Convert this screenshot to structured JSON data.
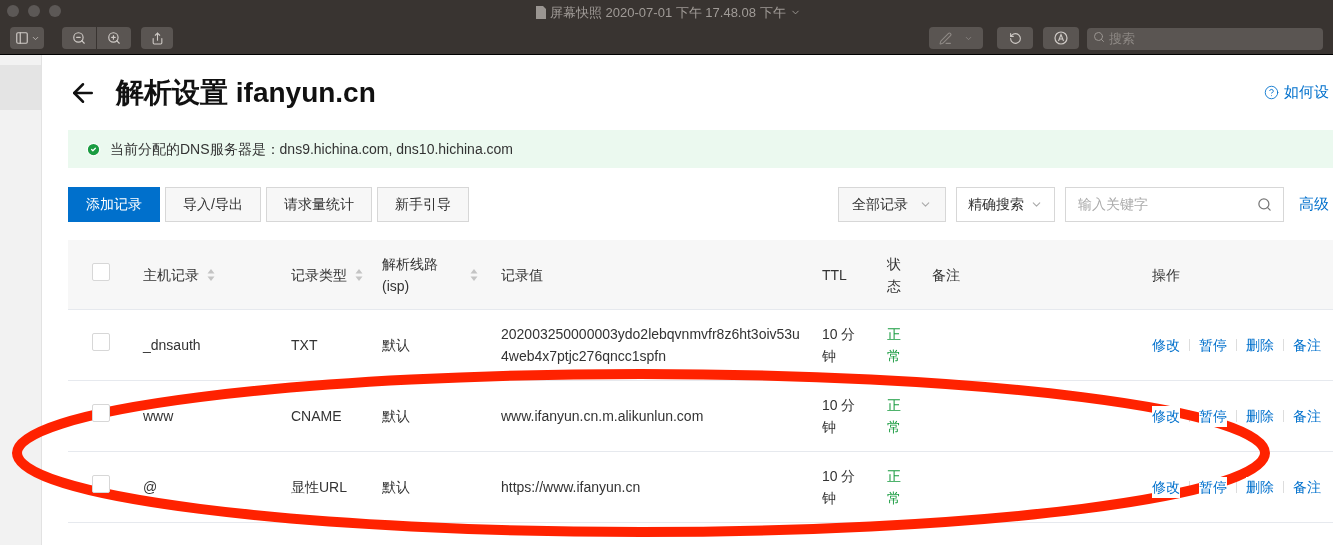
{
  "window": {
    "title": "屏幕快照 2020-07-01 下午 17.48.08 下午"
  },
  "toolbar": {
    "search": {
      "placeholder": "搜索"
    }
  },
  "page": {
    "heading": "解析设置 ifanyun.cn",
    "help_link": "如何设",
    "alert": "当前分配的DNS服务器是：dns9.hichina.com, dns10.hichina.com",
    "actions": [
      {
        "label": "添加记录",
        "kind": "primary"
      },
      {
        "label": "导入/导出",
        "kind": "default"
      },
      {
        "label": "请求量统计",
        "kind": "default"
      },
      {
        "label": "新手引导",
        "kind": "default"
      }
    ],
    "filters": {
      "record_filter": "全部记录",
      "search_mode": "精确搜索",
      "search": {
        "placeholder": "输入关键字"
      },
      "advanced_link": "高级"
    }
  },
  "table": {
    "header_checked": false,
    "columns": [
      {
        "label": "主机记录",
        "sortable": true
      },
      {
        "label": "记录类型",
        "sortable": true
      },
      {
        "label": "解析线路(isp)",
        "sortable": true
      },
      {
        "label": "记录值",
        "sortable": false
      },
      {
        "label": "TTL",
        "sortable": false
      },
      {
        "label": "状态",
        "sortable": false
      },
      {
        "label": "备注",
        "sortable": false
      },
      {
        "label": "操作",
        "sortable": false
      }
    ],
    "rows": [
      {
        "checked": false,
        "host": "_dnsauth",
        "type": "TXT",
        "line": "默认",
        "value": "202003250000003ydo2lebqvnmvfr8z6ht3oiv53u4web4x7ptjc276qncc1spfn",
        "ttl": "10 分钟",
        "status": "正常",
        "actions": [
          "修改",
          "暂停",
          "删除",
          "备注"
        ]
      },
      {
        "checked": false,
        "host": "www",
        "type": "CNAME",
        "line": "默认",
        "value": "www.ifanyun.cn.m.alikunlun.com",
        "ttl": "10 分钟",
        "status": "正常",
        "actions": [
          "修改",
          "暂停",
          "删除",
          "备注"
        ]
      },
      {
        "checked": false,
        "host": "@",
        "type": "显性URL",
        "line": "默认",
        "value": "https://www.ifanyun.cn",
        "ttl": "10 分钟",
        "status": "正常",
        "actions": [
          "修改",
          "暂停",
          "删除",
          "备注"
        ]
      }
    ]
  },
  "annotation": {
    "kind": "ellipse"
  }
}
